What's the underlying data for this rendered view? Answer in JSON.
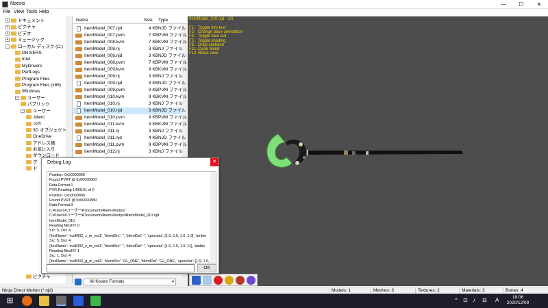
{
  "window": {
    "title": "Noesis",
    "min": "—",
    "max": "☐",
    "close": "✕"
  },
  "menu": [
    "File",
    "View",
    "Tools",
    "Help"
  ],
  "tree": [
    {
      "label": "ドキュメント",
      "level": 1,
      "exp": "+"
    },
    {
      "label": "ピクチャ",
      "level": 1,
      "exp": "+"
    },
    {
      "label": "ビデオ",
      "level": 1,
      "exp": "+"
    },
    {
      "label": "ミュージック",
      "level": 1,
      "exp": "+"
    },
    {
      "label": "ローカル ディスク (C:)",
      "level": 1,
      "exp": "-"
    },
    {
      "label": "DRIVERS",
      "level": 2,
      "exp": ""
    },
    {
      "label": "Intel",
      "level": 2,
      "exp": ""
    },
    {
      "label": "MyDrivers",
      "level": 2,
      "exp": ""
    },
    {
      "label": "PerfLogs",
      "level": 2,
      "exp": ""
    },
    {
      "label": "Program Files",
      "level": 2,
      "exp": ""
    },
    {
      "label": "Program Files (x86)",
      "level": 2,
      "exp": ""
    },
    {
      "label": "Windows",
      "level": 2,
      "exp": ""
    },
    {
      "label": "ユーザー",
      "level": 2,
      "exp": "-"
    },
    {
      "label": "パブリック",
      "level": 3,
      "exp": ""
    },
    {
      "label": "ユーザー",
      "level": 3,
      "exp": "-"
    },
    {
      "label": ".idlerc",
      "level": 4,
      "exp": ""
    },
    {
      "label": ".ssh",
      "level": 4,
      "exp": ""
    },
    {
      "label": "3D オブジェクト",
      "level": 4,
      "exp": ""
    },
    {
      "label": "OneDrive",
      "level": 4,
      "exp": ""
    },
    {
      "label": "アドレス帳",
      "level": 4,
      "exp": ""
    },
    {
      "label": "お気に入り",
      "level": 4,
      "exp": ""
    },
    {
      "label": "ダウンロード",
      "level": 4,
      "exp": ""
    },
    {
      "label": "デ",
      "level": 4,
      "exp": ""
    },
    {
      "label": "ド",
      "level": 4,
      "exp": ""
    }
  ],
  "tree_bottom": {
    "label": "ピクチャ"
  },
  "files": {
    "headers": {
      "name": "Name",
      "size": "Size",
      "type": "Type"
    },
    "rows": [
      {
        "name": "ItemModel_007.njd",
        "size": "4 KB",
        "type": "NJD ファイル",
        "kind": "doc"
      },
      {
        "name": "ItemModel_007.pvm",
        "size": "7 KB",
        "type": "PVM ファイル",
        "kind": "pkg"
      },
      {
        "name": "ItemModel_008.kvm",
        "size": "7 KB",
        "type": "KVM ファイル",
        "kind": "pkg"
      },
      {
        "name": "ItemModel_008.nj",
        "size": "3 KB",
        "type": "NJ ファイル",
        "kind": "pkg"
      },
      {
        "name": "ItemModel_008.njd",
        "size": "3 KB",
        "type": "NJD ファイル",
        "kind": "pkg"
      },
      {
        "name": "ItemModel_008.pvm",
        "size": "7 KB",
        "type": "PVM ファイル",
        "kind": "pkg"
      },
      {
        "name": "ItemModel_009.kvm",
        "size": "9 KB",
        "type": "KVM ファイル",
        "kind": "pkg"
      },
      {
        "name": "ItemModel_009.nj",
        "size": "3 KB",
        "type": "NJ ファイル",
        "kind": "pkg"
      },
      {
        "name": "ItemModel_009.njd",
        "size": "3 KB",
        "type": "NJD ファイル",
        "kind": "doc"
      },
      {
        "name": "ItemModel_009.pvm",
        "size": "9 KB",
        "type": "PVM ファイル",
        "kind": "pkg"
      },
      {
        "name": "ItemModel_010.kvm",
        "size": "9 KB",
        "type": "KVM ファイル",
        "kind": "pkg"
      },
      {
        "name": "ItemModel_010.nj",
        "size": "3 KB",
        "type": "NJ ファイル",
        "kind": "doc"
      },
      {
        "name": "ItemModel_010.njd",
        "size": "3 KB",
        "type": "NJD ファイル",
        "kind": "doc",
        "selected": true
      },
      {
        "name": "ItemModel_010.pvm",
        "size": "9 KB",
        "type": "PVM ファイル",
        "kind": "pkg"
      },
      {
        "name": "ItemModel_011.kvm",
        "size": "9 KB",
        "type": "KVM ファイル",
        "kind": "pkg"
      },
      {
        "name": "ItemModel_011.nj",
        "size": "3 KB",
        "type": "NJ ファイル",
        "kind": "pkg"
      },
      {
        "name": "ItemModel_011.njd",
        "size": "4 KB",
        "type": "NJD ファイル",
        "kind": "doc"
      },
      {
        "name": "ItemModel_011.pvm",
        "size": "9 KB",
        "type": "PVM ファイル",
        "kind": "pkg"
      },
      {
        "name": "ItemModel_012.nj",
        "size": "3 KB",
        "type": "NJ ファイル",
        "kind": "pkg"
      }
    ]
  },
  "viewport": {
    "title": "ItemModel_010.njd - 1/1",
    "help": [
      {
        "key": "F1:",
        "text": "Toggle info text"
      },
      {
        "key": "F2:",
        "text": "Change base orientation"
      },
      {
        "key": "F3:",
        "text": "Toggle face cull"
      },
      {
        "key": "F5:",
        "text": "Toggle shading"
      },
      {
        "key": "F6:",
        "text": "Draw skeleton"
      },
      {
        "key": "F11:",
        "text": "Cycle blend"
      },
      {
        "key": "F12:",
        "text": "Reset view"
      }
    ]
  },
  "format": {
    "label": "All Known Formats"
  },
  "debug": {
    "title": "Debug Log",
    "close": "✕",
    "ok": "OK",
    "lines": [
      "Position: 0x00000060",
      "Found PVRT @ 0x00000060",
      "Data Format:1",
      "PVR Reading 1400161 of 0",
      "Position: 0x00000880",
      "Found PVRT @ 0x00000880",
      "Data Format:3",
      "C:¥Users¥ユーザー¥Documents¥items¥output",
      "C:¥Users¥ユーザー¥Documents¥items¥output¥ItemModel_010.njd",
      "ItemModel_010",
      "Reading Mesh!!! 0",
      "Src: 5, Dst: 4",
      "{'texName': 'xvdtR02_z_m_rod1', 'blendSrc': '', 'blendDst': '', 'specular': [1.0, 1.0, 1.0, 1.0], 'ambie",
      "Src: 5, Dst: 4",
      "{'texName': 'xvdtR02_z_m_rod1', 'blendSrc': '', 'blendDst': '', 'specular': [1.0, 1.0, 1.0, 11], 'ambie",
      "Reading Mesh!!! 1",
      "Src: 1, Dst: 4",
      "{'texName': 'xvdtR02_g_m_rod2', 'blendSrc': 'GL_ONE', 'blendDst': 'GL_ONE', 'specular': [1.0, 1.0,"
    ]
  },
  "status": [
    {
      "text": "Ninja Direct Motion (*.njd)"
    },
    {
      "text": "Models: 1"
    },
    {
      "text": "Meshes: 3"
    },
    {
      "text": "Textures: 2"
    },
    {
      "text": "Materials: 3"
    },
    {
      "text": "Bones: 4"
    }
  ],
  "taskbar": {
    "time": "18:06",
    "date": "2020/12/09",
    "ime": "A",
    "tray": [
      "^",
      "⊡",
      "♪",
      "⊟"
    ]
  },
  "colors": {
    "accent": "#f2d200",
    "viewport_bg": "#4d4d4d",
    "close_red": "#e81123",
    "selection": "#cce8ff"
  }
}
